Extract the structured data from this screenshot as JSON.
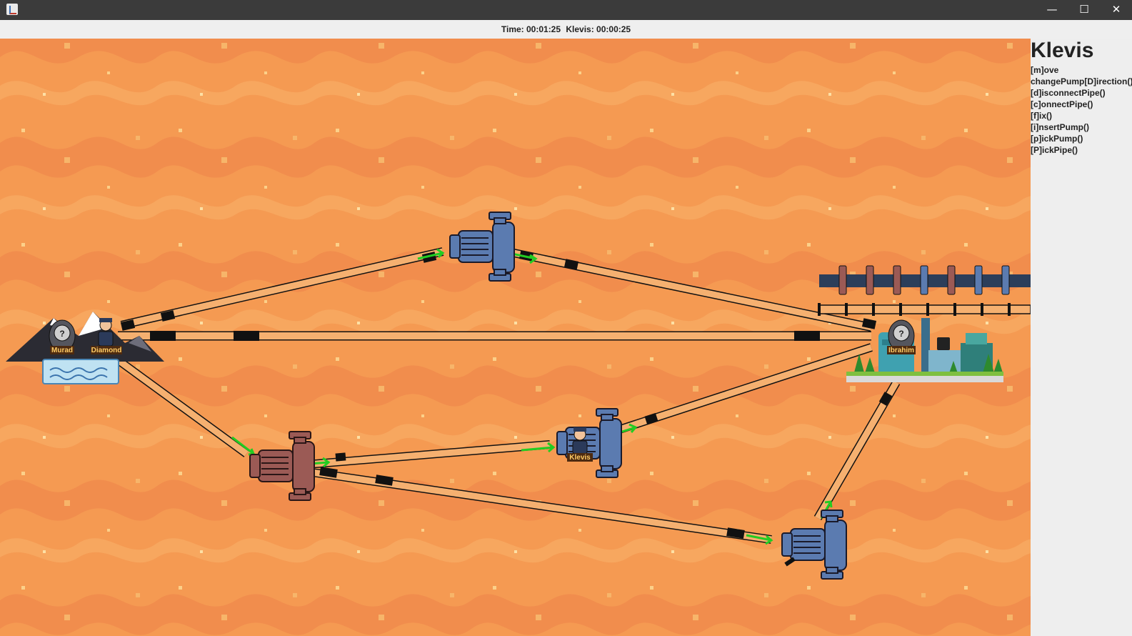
{
  "window": {
    "minimize_glyph": "—",
    "maximize_glyph": "☐",
    "close_glyph": "✕"
  },
  "status": {
    "time_text": "Time: 00:01:25",
    "player_time_text": "Klevis: 00:00:25"
  },
  "side_panel": {
    "player_name": "Klevis",
    "commands": [
      "[m]ove",
      "changePump[D]irection()",
      "[d]isconnectPipe()",
      "[c]onnectPipe()",
      "[f]ix()",
      "[i]nsertPump()",
      "[p]ickPump()",
      "[P]ickPipe()"
    ]
  },
  "board": {
    "background_color": "#f59a52",
    "source": {
      "name": "mountain-spring",
      "players": [
        "Murad",
        "Diamond"
      ]
    },
    "cistern": {
      "name": "city-cistern",
      "players": [
        "Ibrahim"
      ]
    },
    "pumps": [
      {
        "id": "pump-top",
        "color": "blue",
        "players": []
      },
      {
        "id": "pump-left",
        "color": "red",
        "players": []
      },
      {
        "id": "pump-middle",
        "color": "blue",
        "players": [
          "Klevis"
        ]
      },
      {
        "id": "pump-bottom-right",
        "color": "blue",
        "players": []
      }
    ],
    "pump_inventory_colors": [
      "red",
      "red",
      "red",
      "blue",
      "red",
      "blue",
      "blue"
    ],
    "pipe_inventory_count": 7
  },
  "colors": {
    "pipe_fill": "#f5b070",
    "flow_arrow": "#22cc22",
    "pump_blue": "#5b7bb0",
    "pump_red": "#9b5a55",
    "name_tag": "#4d2a10",
    "name_text": "#ffcc66"
  }
}
